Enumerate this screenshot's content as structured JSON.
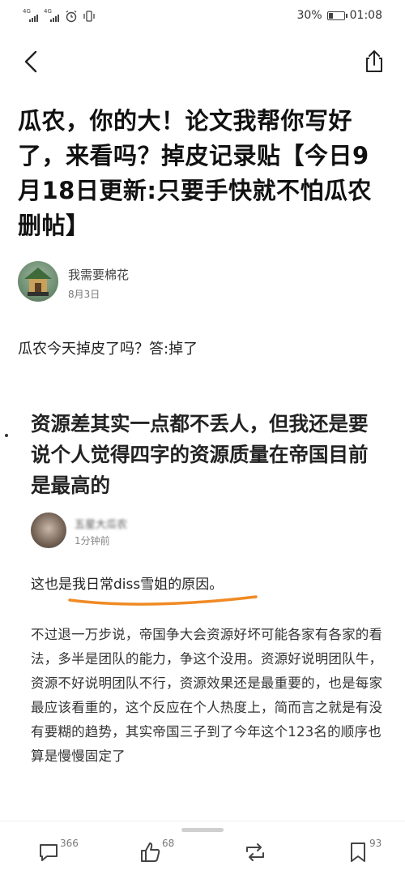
{
  "status": {
    "signal_1": "4G",
    "signal_2": "4G",
    "battery": "30%",
    "time": "01:08",
    "battery_level": 0.3
  },
  "post": {
    "title": "瓜农，你的大！论文我帮你写好了，来看吗？掉皮记录贴【今日9月18日更新:只要手快就不怕瓜农删帖】",
    "author_name": "我需要棉花",
    "author_date": "8月3日",
    "intro": "瓜农今天掉皮了吗？答:掉了"
  },
  "embedded": {
    "title": "资源差其实一点都不丢人，但我还是要说个人觉得四字的资源质量在帝国目前是最高的",
    "author_name": "五星大瓜农",
    "time": "1分钟前",
    "highlight": "这也是我日常diss雪姐的原因。",
    "body": "不过退一万步说，帝国争大会资源好坏可能各家有各家的看法，多半是团队的能力，争这个没用。资源好说明团队牛，资源不好说明团队不行，资源效果还是最重要的，也是每家最应该看重的，这个反应在个人热度上，简而言之就是有没有要糊的趋势，其实帝国三子到了今年这个123名的顺序也算是慢慢固定了"
  },
  "bottom": {
    "comments": "366",
    "likes": "68",
    "reposts": "",
    "favorites": "93"
  },
  "colors": {
    "underline": "#f08a24",
    "text": "#111111",
    "muted": "#777777"
  }
}
